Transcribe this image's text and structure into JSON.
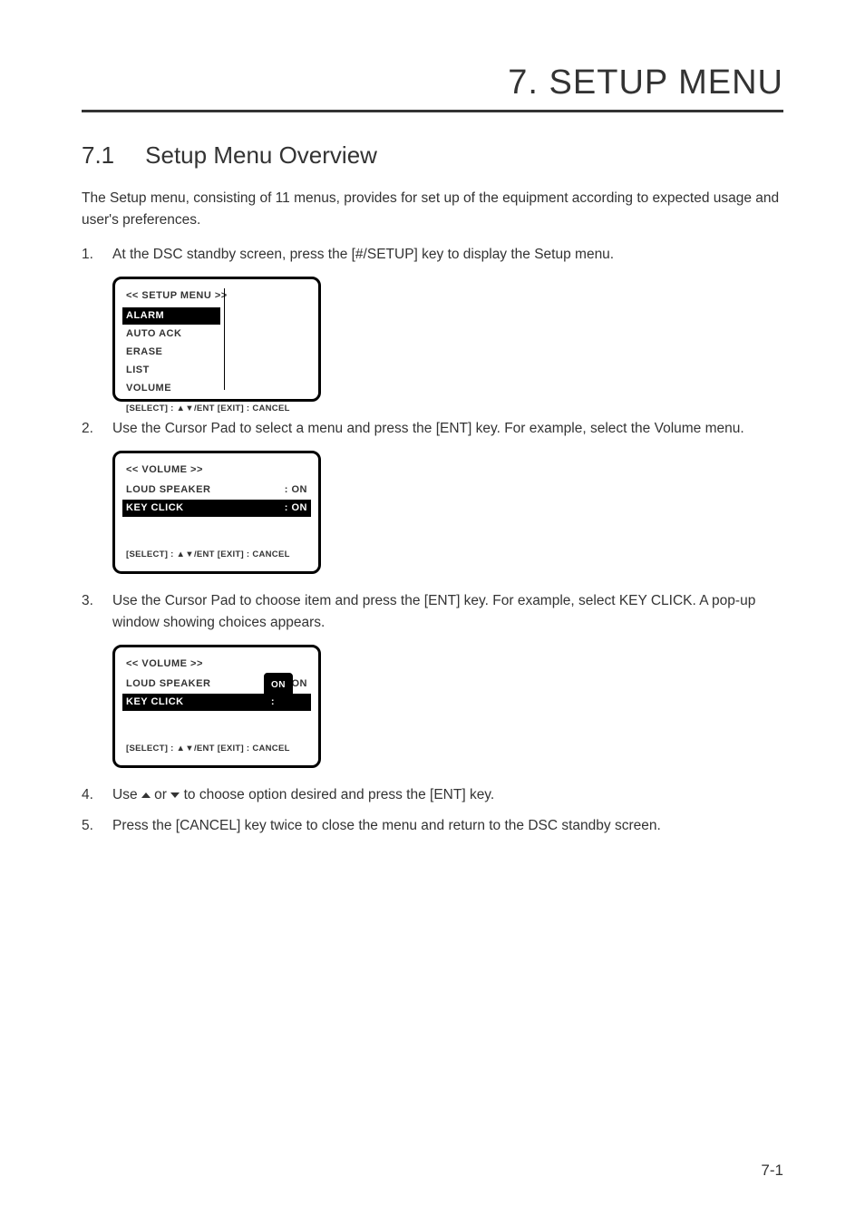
{
  "chapter": {
    "title": "7.  SETUP MENU"
  },
  "section": {
    "number": "7.1",
    "title": "Setup Menu Overview"
  },
  "intro": "The Setup menu, consisting of 11 menus, provides for set up of the equipment according to expected usage and user's preferences.",
  "steps": {
    "s1": "At the DSC standby screen, press the [#/SETUP] key to display the Setup menu.",
    "s2": "Use the Cursor Pad to select a menu and press the [ENT] key. For example, select the Volume menu.",
    "s3": "Use the Cursor Pad to choose item and press the [ENT] key. For example, select KEY CLICK. A pop-up window showing choices appears.",
    "s4_a": "Use ",
    "s4_b": " or ",
    "s4_c": " to choose option desired and press the [ENT] key.",
    "s5": "Press the [CANCEL] key twice to close the menu and return to the DSC standby screen."
  },
  "screen1": {
    "title": "<< SETUP MENU >>",
    "items": [
      "ALARM",
      "AUTO ACK",
      "ERASE",
      "LIST",
      "VOLUME"
    ],
    "help": "[SELECT] : ▲▼/ENT  [EXIT] : CANCEL"
  },
  "screen2": {
    "title": "<< VOLUME >>",
    "rows": [
      {
        "label": "LOUD SPEAKER",
        "value": ": ON"
      },
      {
        "label": "KEY CLICK",
        "value": ": ON"
      }
    ],
    "help": "[SELECT] : ▲▼/ENT  [EXIT] : CANCEL"
  },
  "screen3": {
    "title": "<< VOLUME >>",
    "rows": [
      {
        "label": "LOUD SPEAKER",
        "value": ": ON"
      },
      {
        "label": "KEY CLICK",
        "value": ":"
      }
    ],
    "popup": "ON",
    "help": "[SELECT] : ▲▼/ENT  [EXIT] : CANCEL"
  },
  "pageNumber": "7-1"
}
